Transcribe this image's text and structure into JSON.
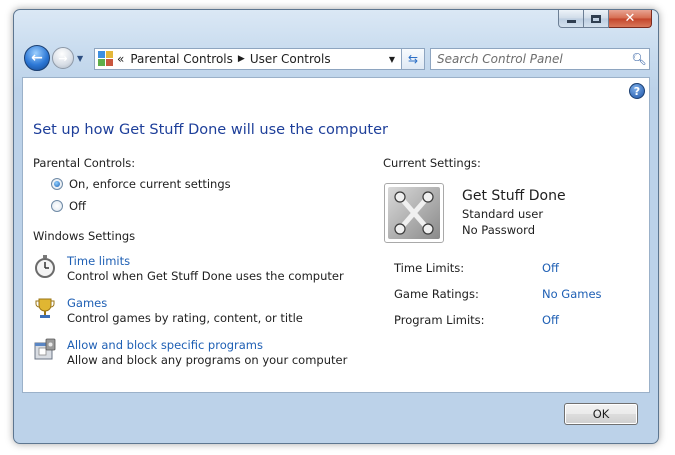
{
  "window": {
    "accent": "#1e3f9a",
    "link_color": "#1e5fb4"
  },
  "caption": {
    "minimize_icon": "minimize-icon",
    "maximize_icon": "maximize-icon",
    "close_glyph": "✕"
  },
  "nav": {
    "back_glyph": "←",
    "forward_glyph": "→",
    "breadcrumb_prefix": "«",
    "breadcrumb": [
      "Parental Controls",
      "User Controls"
    ],
    "breadcrumb_sep": "▶",
    "search_placeholder": "Search Control Panel"
  },
  "main": {
    "title": "Set up how Get Stuff Done will use the computer",
    "parental_controls_label": "Parental Controls:",
    "radio_options": [
      {
        "label": "On, enforce current settings",
        "checked": true
      },
      {
        "label": "Off",
        "checked": false
      }
    ],
    "windows_settings_label": "Windows Settings",
    "windows_settings": [
      {
        "link": "Time limits",
        "desc": "Control when Get Stuff Done uses the computer",
        "icon": "stopwatch-icon"
      },
      {
        "link": "Games",
        "desc": "Control games by rating, content, or title",
        "icon": "trophy-icon"
      },
      {
        "link": "Allow and block specific programs",
        "desc": "Allow and block any programs on your computer",
        "icon": "programs-icon"
      }
    ]
  },
  "current": {
    "label": "Current Settings:",
    "user_name": "Get Stuff Done",
    "user_type": "Standard user",
    "user_password": "No Password",
    "settings": [
      {
        "label": "Time Limits:",
        "value": "Off"
      },
      {
        "label": "Game Ratings:",
        "value": "No Games"
      },
      {
        "label": "Program Limits:",
        "value": "Off"
      }
    ]
  },
  "footer": {
    "ok_label": "OK"
  }
}
